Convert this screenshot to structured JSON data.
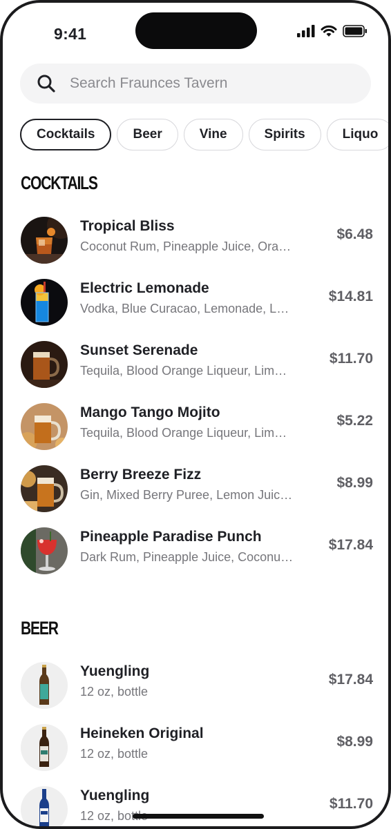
{
  "status": {
    "time": "9:41"
  },
  "search": {
    "placeholder": "Search Fraunces Tavern"
  },
  "chips": [
    "Cocktails",
    "Beer",
    "Vine",
    "Spirits",
    "Liquo"
  ],
  "sections": {
    "cocktails": {
      "title": "COCKTAILS",
      "items": [
        {
          "name": "Tropical Bliss",
          "desc": "Coconut Rum, Pineapple Juice, Ora…",
          "price": "$6.48"
        },
        {
          "name": "Electric Lemonade",
          "desc": "Vodka, Blue Curacao, Lemonade, L…",
          "price": "$14.81"
        },
        {
          "name": "Sunset Serenade",
          "desc": "Tequila, Blood Orange Liqueur, Lim…",
          "price": "$11.70"
        },
        {
          "name": "Mango Tango Mojito",
          "desc": "Tequila, Blood Orange Liqueur, Lim…",
          "price": "$5.22"
        },
        {
          "name": "Berry Breeze Fizz",
          "desc": "Gin, Mixed Berry Puree, Lemon Juic…",
          "price": "$8.99"
        },
        {
          "name": "Pineapple Paradise Punch",
          "desc": "Dark Rum, Pineapple Juice, Coconu…",
          "price": "$17.84"
        }
      ]
    },
    "beer": {
      "title": "BEER",
      "items": [
        {
          "name": "Yuengling",
          "desc": "12 oz, bottle",
          "price": "$17.84"
        },
        {
          "name": "Heineken Original",
          "desc": "12 oz, bottle",
          "price": "$8.99"
        },
        {
          "name": "Yuengling",
          "desc": "12 oz, bottle",
          "price": "$11.70"
        }
      ]
    }
  },
  "icons": {
    "search": "search-icon",
    "signal": "signal-icon",
    "wifi": "wifi-icon",
    "battery": "battery-icon"
  },
  "colors": {
    "text": "#1f2025",
    "muted": "#76767b",
    "price": "#5f5f64",
    "chip_border": "#d8d8dc",
    "search_bg": "#f4f4f5"
  }
}
